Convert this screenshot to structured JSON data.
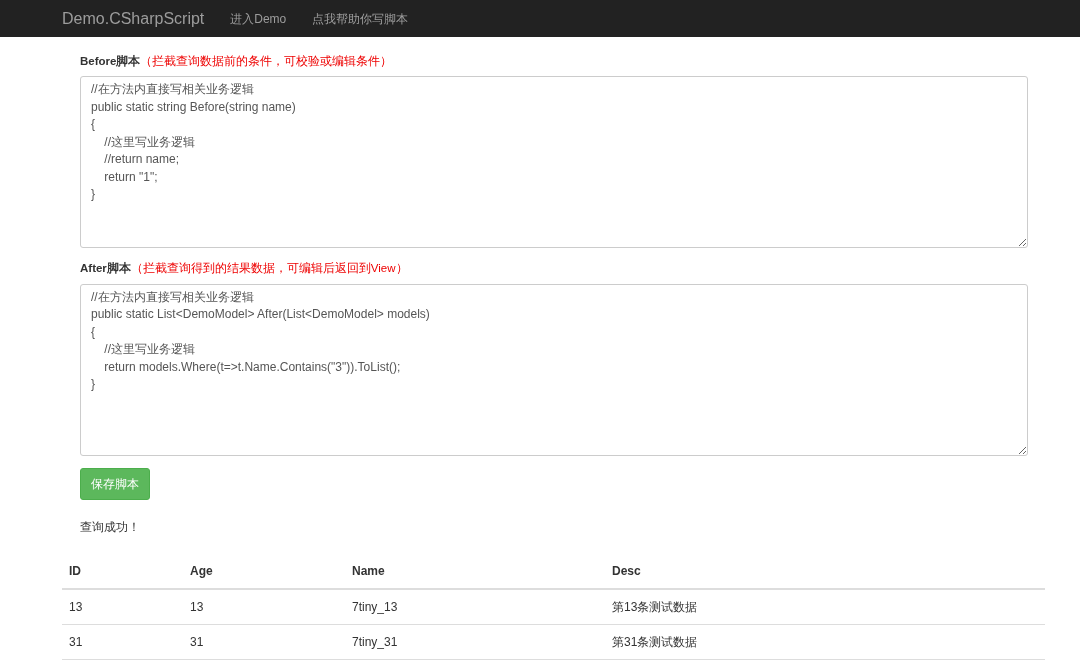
{
  "navbar": {
    "brand": "Demo.CSharpScript",
    "links": [
      {
        "label": "进入Demo"
      },
      {
        "label": "点我帮助你写脚本"
      }
    ]
  },
  "scripts": [
    {
      "label": "Before脚本",
      "hint": "（拦截查询数据前的条件，可校验或编辑条件）",
      "code": "//在方法内直接写相关业务逻辑\npublic static string Before(string name)\n{\n\t//这里写业务逻辑\n\t//return name;\n\treturn \"1\";\n}"
    },
    {
      "label": "After脚本",
      "hint": "（拦截查询得到的结果数据，可编辑后返回到View）",
      "code": "//在方法内直接写相关业务逻辑\npublic static List<DemoModel> After(List<DemoModel> models)\n{\n\t//这里写业务逻辑\n\treturn models.Where(t=>t.Name.Contains(\"3\")).ToList();\n}"
    }
  ],
  "save_button": "保存脚本",
  "message": "查询成功！",
  "table": {
    "columns": [
      "ID",
      "Age",
      "Name",
      "Desc"
    ],
    "rows": [
      [
        "13",
        "13",
        "7tiny_13",
        "第13条测试数据"
      ],
      [
        "31",
        "31",
        "7tiny_31",
        "第31条测试数据"
      ]
    ]
  }
}
